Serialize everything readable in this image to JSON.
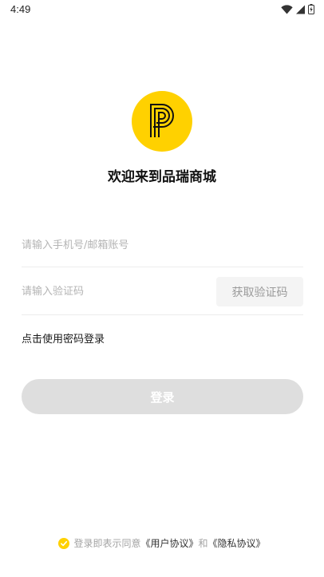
{
  "status_bar": {
    "time": "4:49",
    "icons": [
      "wifi-icon",
      "signal-icon",
      "battery-charging-icon"
    ]
  },
  "app": {
    "logo_icon": "p-logo-icon",
    "title": "欢迎来到品瑞商城"
  },
  "form": {
    "phone_placeholder": "请输入手机号/邮箱账号",
    "code_placeholder": "请输入验证码",
    "get_code_label": "获取验证码",
    "password_login_link": "点击使用密码登录",
    "login_label": "登录"
  },
  "agreement": {
    "prefix": "登录即表示同意",
    "user_agreement": "《用户协议》",
    "conjunction": "和",
    "privacy_policy": "《隐私协议》"
  },
  "colors": {
    "accent_yellow": "#ffd100",
    "button_disabled": "#dedede",
    "placeholder": "#b4b4b4"
  }
}
